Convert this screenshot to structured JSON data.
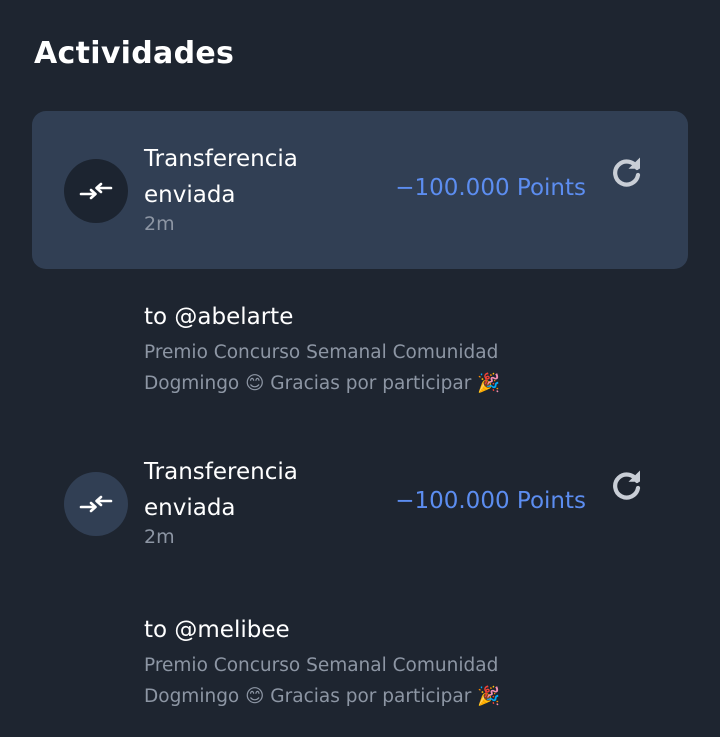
{
  "header": {
    "title": "Actividades"
  },
  "activities": [
    {
      "title": "Transferencia enviada",
      "time": "2m",
      "amount": "−100.000 Points",
      "recipient": "to @abelarte",
      "message_line1": "Premio Concurso Semanal Comunidad",
      "message_line2": "Dogmingo 😊 Gracias por participar 🎉"
    },
    {
      "title": "Transferencia enviada",
      "time": "2m",
      "amount": "−100.000 Points",
      "recipient": "to @melibee",
      "message_line1": "Premio Concurso Semanal Comunidad",
      "message_line2": "Dogmingo 😊 Gracias por participar 🎉"
    }
  ],
  "colors": {
    "background": "#1e2530",
    "card_highlight": "#313f54",
    "amount": "#5c8df0",
    "muted_text": "#8d96a4"
  },
  "icons": {
    "transfer": "transfer-arrows-icon",
    "refresh": "refresh-icon"
  }
}
